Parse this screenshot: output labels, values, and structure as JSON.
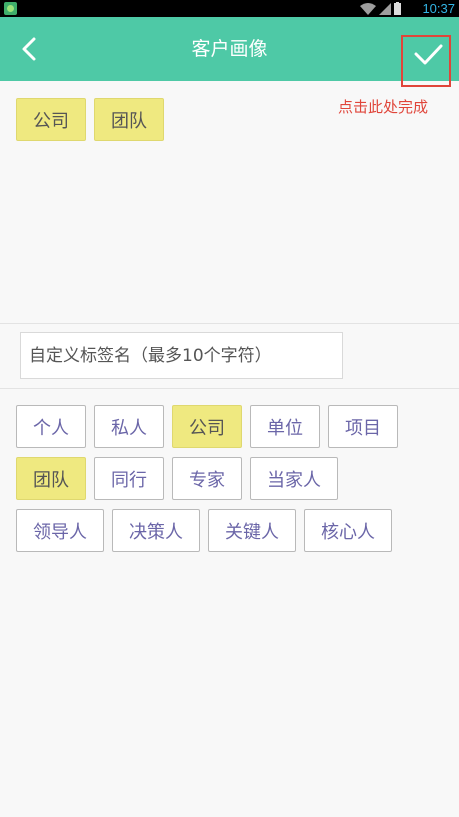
{
  "status": {
    "time": "10:37"
  },
  "header": {
    "title": "客户画像",
    "back_icon": "chevron-left-icon",
    "confirm_icon": "check-icon"
  },
  "hint": "点击此处完成",
  "selected_tags": [
    "公司",
    "团队"
  ],
  "custom_input": {
    "placeholder": "自定义标签名（最多10个字符）",
    "value": ""
  },
  "tag_pool": {
    "row1": [
      {
        "label": "个人",
        "selected": false
      },
      {
        "label": "私人",
        "selected": false
      },
      {
        "label": "公司",
        "selected": true
      },
      {
        "label": "单位",
        "selected": false
      },
      {
        "label": "项目",
        "selected": false
      }
    ],
    "row2": [
      {
        "label": "团队",
        "selected": true
      },
      {
        "label": "同行",
        "selected": false
      },
      {
        "label": "专家",
        "selected": false
      },
      {
        "label": "当家人",
        "selected": false
      }
    ],
    "row3": [
      {
        "label": "领导人",
        "selected": false
      },
      {
        "label": "决策人",
        "selected": false
      },
      {
        "label": "关键人",
        "selected": false
      },
      {
        "label": "核心人",
        "selected": false
      }
    ]
  },
  "colors": {
    "header": "#4ec9a6",
    "selected_tag": "#efe980",
    "hint": "#e0453a",
    "tag_text": "#6b66a8"
  }
}
